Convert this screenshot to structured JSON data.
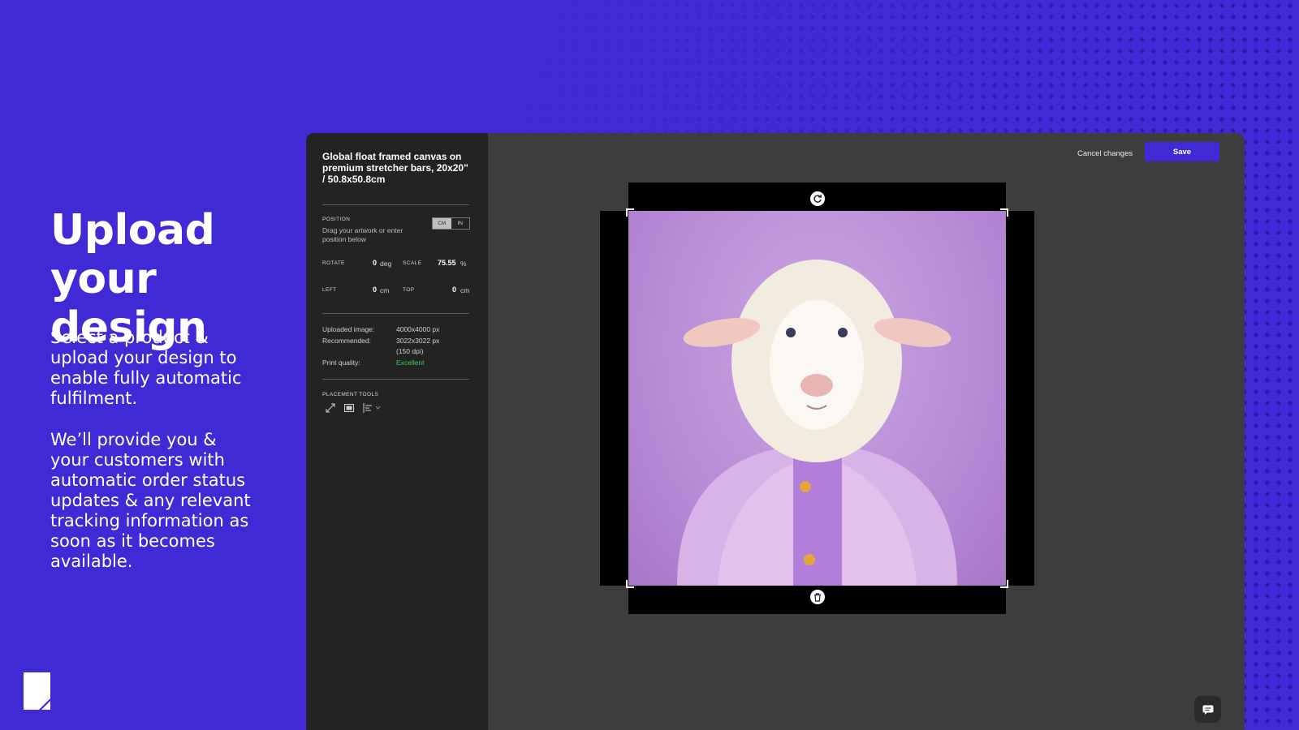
{
  "hero": {
    "headline_line1": "Upload",
    "headline_line2": "your design",
    "paragraph1": "Select a product & upload your design to enable fully automatic fulfilment.",
    "paragraph2": "We’ll provide you & your customers with automatic order status updates & any relevant tracking information as soon as it becomes available."
  },
  "brand": {
    "logo_icon": "brand-logo-icon"
  },
  "editor": {
    "product_title": "Global float framed canvas on premium stretcher bars, 20x20\" / 50.8x50.8cm",
    "position": {
      "label": "POSITION",
      "hint": "Drag your artwork or enter position below",
      "units": [
        "CM",
        "IN"
      ],
      "selected_unit": "CM"
    },
    "rotate": {
      "label": "ROTATE",
      "value": "0",
      "unit": "deg"
    },
    "scale": {
      "label": "SCALE",
      "value": "75.55",
      "unit": "%"
    },
    "left": {
      "label": "LEFT",
      "value": "0",
      "unit": "cm"
    },
    "top": {
      "label": "TOP",
      "value": "0",
      "unit": "cm"
    },
    "info": {
      "uploaded_label": "Uploaded image:",
      "uploaded_value": "4000x4000 px",
      "recommended_label": "Recommended:",
      "recommended_value": "3022x3022 px",
      "recommended_dpi": "(150 dpi)",
      "quality_label": "Print quality:",
      "quality_value": "Excellent"
    },
    "placement_tools": {
      "label": "PLACEMENT TOOLS",
      "icons": [
        "expand-icon",
        "fit-icon",
        "align-left-icon",
        "chevron-down-icon"
      ]
    },
    "cancel_label": "Cancel changes",
    "save_label": "Save"
  },
  "colors": {
    "background": "#4129d6",
    "editor_bg": "#3d3d3d",
    "sidebar_bg": "#232323",
    "accent": "#4129d6",
    "quality_good": "#3ecf5a"
  }
}
